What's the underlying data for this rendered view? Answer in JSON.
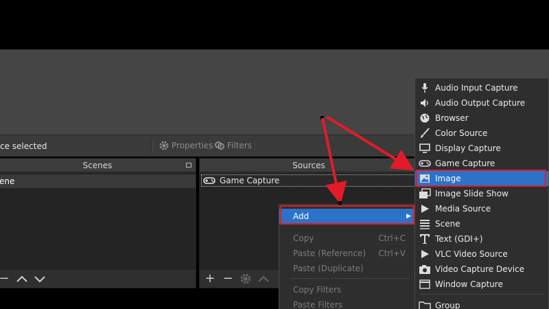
{
  "toolbar": {
    "status_text": "ce selected",
    "properties_label": "Properties",
    "filters_label": "Filters"
  },
  "scenes": {
    "title": "Scenes",
    "selected_scene": "ene"
  },
  "sources": {
    "title": "Sources",
    "items": [
      {
        "label": "Game Capture",
        "icon": "gamepad-icon"
      }
    ]
  },
  "context_menu": {
    "add": {
      "label": "Add"
    },
    "copy": {
      "label": "Copy",
      "shortcut": "Ctrl+C"
    },
    "paste_ref": {
      "label": "Paste (Reference)",
      "shortcut": "Ctrl+V"
    },
    "paste_dup": {
      "label": "Paste (Duplicate)"
    },
    "copy_filters": {
      "label": "Copy Filters"
    },
    "paste_filters": {
      "label": "Paste Filters"
    }
  },
  "add_submenu": {
    "selected": "Image",
    "items": [
      {
        "label": "Audio Input Capture",
        "icon": "microphone-icon"
      },
      {
        "label": "Audio Output Capture",
        "icon": "speaker-icon"
      },
      {
        "label": "Browser",
        "icon": "globe-icon"
      },
      {
        "label": "Color Source",
        "icon": "paint-brush-icon"
      },
      {
        "label": "Display Capture",
        "icon": "monitor-icon"
      },
      {
        "label": "Game Capture",
        "icon": "gamepad-icon"
      },
      {
        "label": "Image",
        "icon": "image-icon"
      },
      {
        "label": "Image Slide Show",
        "icon": "slideshow-icon"
      },
      {
        "label": "Media Source",
        "icon": "play-icon"
      },
      {
        "label": "Scene",
        "icon": "list-icon"
      },
      {
        "label": "Text (GDI+)",
        "icon": "text-icon"
      },
      {
        "label": "VLC Video Source",
        "icon": "play-icon"
      },
      {
        "label": "Video Capture Device",
        "icon": "camera-icon"
      },
      {
        "label": "Window Capture",
        "icon": "window-icon"
      },
      {
        "label": "Group",
        "icon": "folder-icon"
      }
    ]
  },
  "colors": {
    "accent": "#2b73c8",
    "highlight": "#e21b2a"
  }
}
